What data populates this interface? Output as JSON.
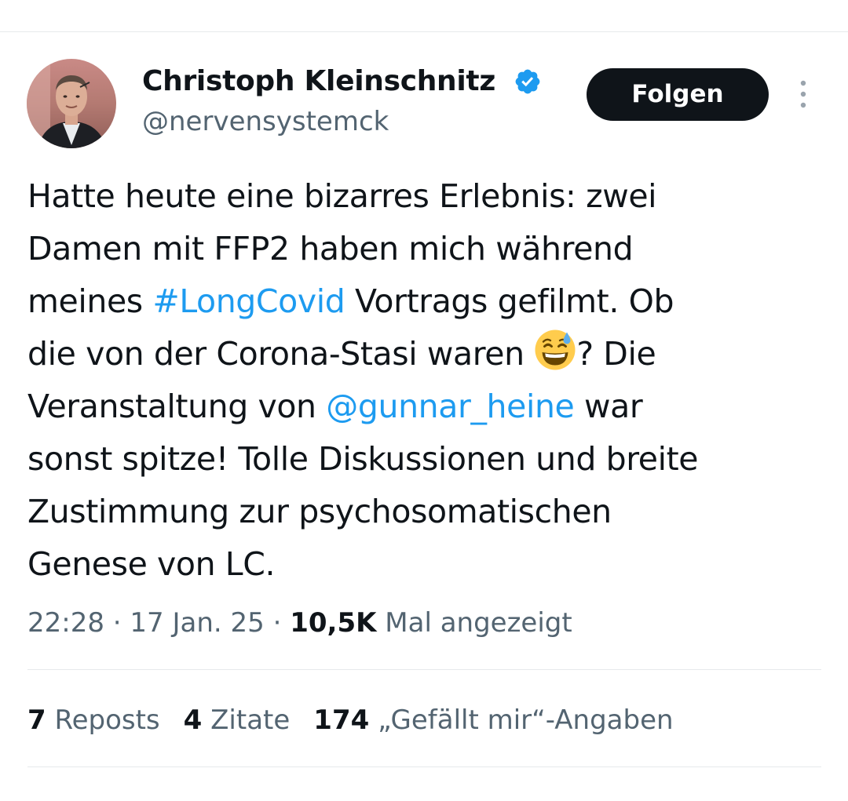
{
  "author": {
    "name": "Christoph Kleinschnitz",
    "handle": "@nervensystemck",
    "verified": true
  },
  "follow_button_label": "Folgen",
  "icons": {
    "verified": "verified-badge-icon",
    "more": "more-vertical-icon",
    "emoji": "grinning-face-with-sweat-emoji"
  },
  "tweet": {
    "line1": "Hatte heute eine bizarres Erlebnis: zwei",
    "line2": "Damen mit FFP2 haben mich während",
    "line3_pre": "meines ",
    "hashtag": "#LongCovid",
    "line3_post": " Vortrags gefilmt. Ob",
    "line4_pre": "die von der Corona-Stasi waren ",
    "line4_post": "? Die",
    "line5_pre": "Veranstaltung von ",
    "mention": "@gunnar_heine",
    "line5_post": " war",
    "line6": "sonst spitze! Tolle Diskussionen und breite",
    "line7": "Zustimmung zur psychosomatischen",
    "line8": "Genese von LC."
  },
  "meta": {
    "time": "22:28",
    "separator": " · ",
    "date": "17 Jan. 25",
    "views": "10,5K",
    "views_label": "Mal angezeigt"
  },
  "stats": {
    "reposts_count": "7",
    "reposts_label": "Reposts",
    "quotes_count": "4",
    "quotes_label": "Zitate",
    "likes_count": "174",
    "likes_label": "„Gefällt mir“-Angaben"
  },
  "colors": {
    "text": "#0f1419",
    "secondary": "#536471",
    "link": "#1d9bf0",
    "divider": "#e6e9eb",
    "button_bg": "#0f1419"
  }
}
